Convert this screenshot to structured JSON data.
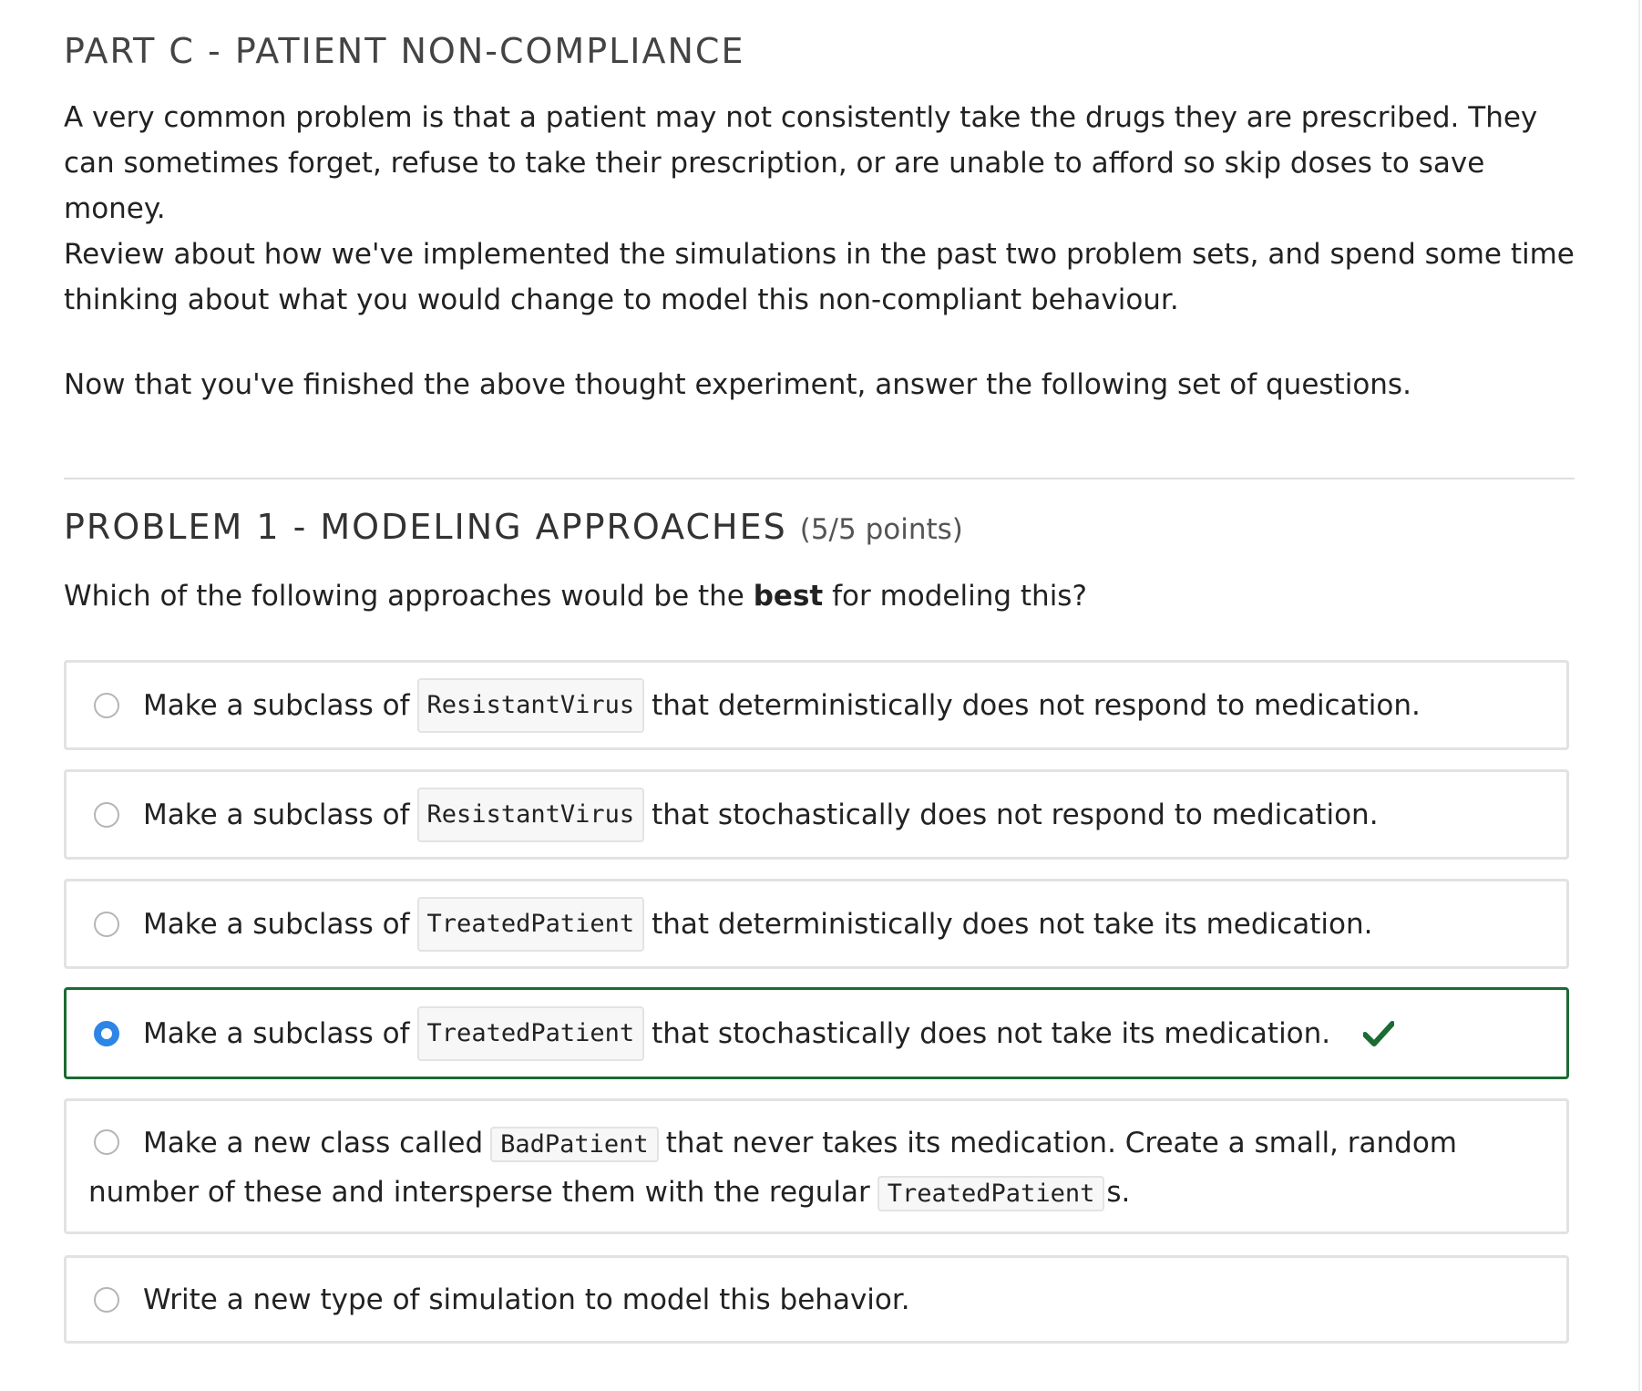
{
  "part": {
    "heading": "PART C - PATIENT NON-COMPLIANCE",
    "paragraphs": [
      "A very common problem is that a patient may not consistently take the drugs they are prescribed. They can sometimes forget, refuse to take their prescription, or are unable to afford so skip doses to save money.",
      "Review about how we've implemented the simulations in the past two problem sets, and spend some time thinking about what you would change to model this non-compliant behaviour.",
      "Now that you've finished the above thought experiment, answer the following set of questions."
    ]
  },
  "problem": {
    "title": "PROBLEM 1 - MODELING APPROACHES",
    "points": "(5/5 points)",
    "question_before": "Which of the following approaches would be the ",
    "question_emphasis": "best",
    "question_after": " for modeling this?",
    "options": [
      {
        "before": "Make a subclass of",
        "code": "ResistantVirus",
        "after": "that deterministically does not respond to medication."
      },
      {
        "before": "Make a subclass of",
        "code": "ResistantVirus",
        "after": "that stochastically does not respond to medication."
      },
      {
        "before": "Make a subclass of",
        "code": "TreatedPatient",
        "after": "that deterministically does not take its medication."
      },
      {
        "before": "Make a subclass of",
        "code": "TreatedPatient",
        "after": "that stochastically does not take its medication."
      },
      {
        "before": "Make a new class called",
        "code": "BadPatient",
        "after": "that never takes its medication. Create a small, random number of these and intersperse them with the regular",
        "code2": "TreatedPatient",
        "after2": "s."
      },
      {
        "text": "Write a new type of simulation to model this behavior."
      }
    ],
    "selected_option": 4,
    "result": "correct"
  },
  "colors": {
    "correct_border": "#1b6b32",
    "correct_check": "#1b6b32",
    "radio_selected": "#2d86e6"
  }
}
